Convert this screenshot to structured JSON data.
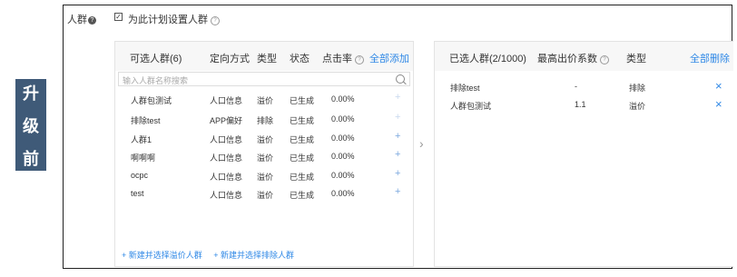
{
  "side_label": [
    "升",
    "级",
    "前"
  ],
  "header": {
    "label": "人群",
    "checkbox_label": "为此计划设置人群",
    "checkbox_checked": true
  },
  "left_panel": {
    "columns": [
      "可选人群(6)",
      "定向方式",
      "类型",
      "状态",
      "点击率",
      "全部添加"
    ],
    "search_placeholder": "输入人群名称搜索",
    "rows": [
      {
        "name": "人群包测试",
        "method": "人口信息",
        "type": "溢价",
        "status": "已生成",
        "ctr": "0.00%",
        "added": true
      },
      {
        "name": "排除test",
        "method": "APP偏好",
        "type": "排除",
        "status": "已生成",
        "ctr": "0.00%",
        "added": true
      },
      {
        "name": "人群1",
        "method": "人口信息",
        "type": "溢价",
        "status": "已生成",
        "ctr": "0.00%",
        "added": false
      },
      {
        "name": "啊啊啊",
        "method": "人口信息",
        "type": "溢价",
        "status": "已生成",
        "ctr": "0.00%",
        "added": false
      },
      {
        "name": "ocpc",
        "method": "人口信息",
        "type": "溢价",
        "status": "已生成",
        "ctr": "0.00%",
        "added": false
      },
      {
        "name": "test",
        "method": "人口信息",
        "type": "溢价",
        "status": "已生成",
        "ctr": "0.00%",
        "added": false
      }
    ],
    "footer_links": [
      "+ 新建并选择溢价人群",
      "+ 新建并选择排除人群"
    ]
  },
  "right_panel": {
    "columns": [
      "已选人群(2/1000)",
      "最高出价系数",
      "类型",
      "全部删除"
    ],
    "rows": [
      {
        "name": "排除test",
        "coef": "-",
        "type": "排除"
      },
      {
        "name": "人群包测试",
        "coef": "1.1",
        "type": "溢价"
      }
    ]
  },
  "colors": {
    "accent": "#2f88e6",
    "side_bg": "#3f5a78"
  }
}
